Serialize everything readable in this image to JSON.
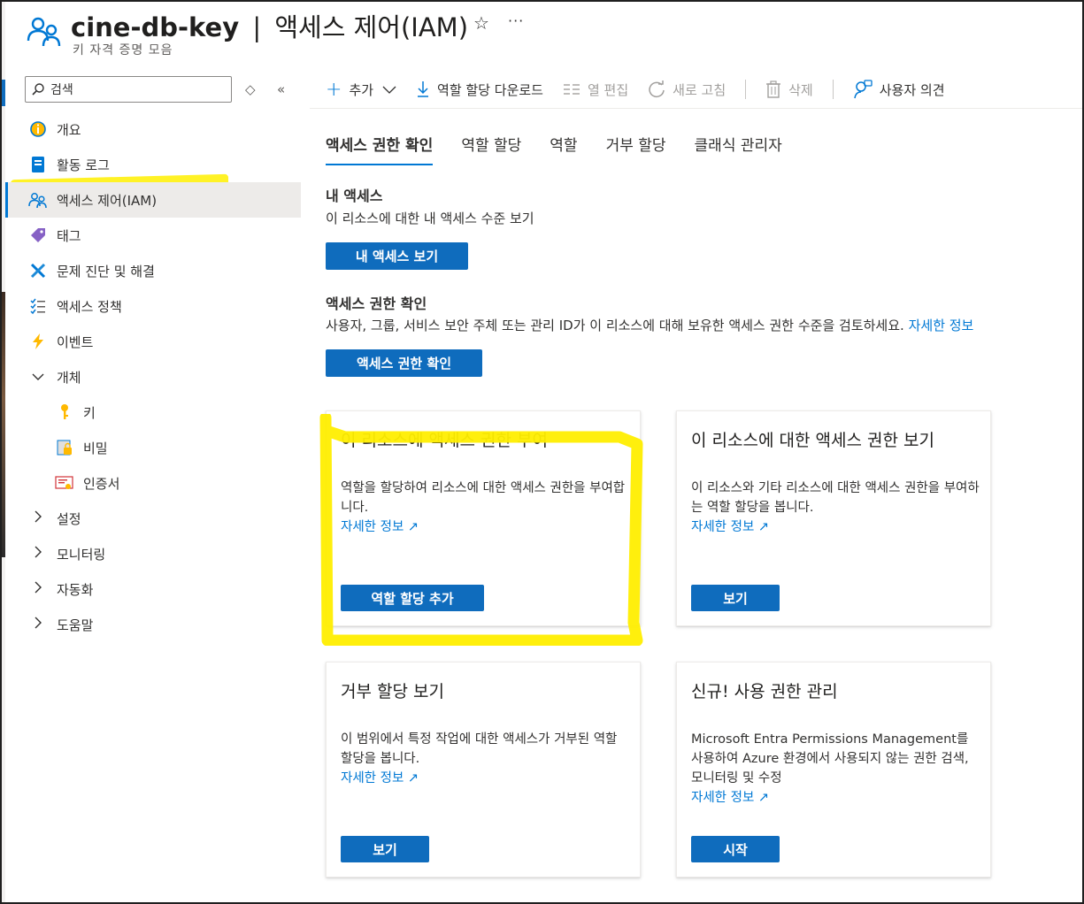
{
  "header": {
    "resource": "cine-db-key",
    "separator": "|",
    "page": "액세스 제어(IAM)",
    "subtitle": "키 자격 증명 모음",
    "star_icon": "star-icon",
    "more": "···"
  },
  "sidebar": {
    "search_placeholder": "검색",
    "items": [
      {
        "label": "개요",
        "icon": "overview-icon"
      },
      {
        "label": "활동 로그",
        "icon": "activity-log-icon"
      },
      {
        "label": "액세스 제어(IAM)",
        "icon": "iam-icon"
      },
      {
        "label": "태그",
        "icon": "tag-icon"
      },
      {
        "label": "문제 진단 및 해결",
        "icon": "diagnose-icon"
      },
      {
        "label": "액세스 정책",
        "icon": "access-policy-icon"
      },
      {
        "label": "이벤트",
        "icon": "events-icon"
      },
      {
        "label": "개체",
        "icon": "chevron-down-icon"
      },
      {
        "label": "키",
        "icon": "key-icon"
      },
      {
        "label": "비밀",
        "icon": "secret-icon"
      },
      {
        "label": "인증서",
        "icon": "certificate-icon"
      },
      {
        "label": "설정",
        "icon": "chevron-right-icon"
      },
      {
        "label": "모니터링",
        "icon": "chevron-right-icon"
      },
      {
        "label": "자동화",
        "icon": "chevron-right-icon"
      },
      {
        "label": "도움말",
        "icon": "chevron-right-icon"
      }
    ]
  },
  "toolbar": {
    "add": "추가",
    "download": "역할 할당 다운로드",
    "edit_columns": "열 편집",
    "refresh": "새로 고침",
    "delete": "삭제",
    "feedback": "사용자 의견"
  },
  "tabs": [
    "액세스 권한 확인",
    "역할 할당",
    "역할",
    "거부 할당",
    "클래식 관리자"
  ],
  "my_access": {
    "heading": "내 액세스",
    "text": "이 리소스에 대한 내 액세스 수준 보기",
    "button": "내 액세스 보기"
  },
  "check_access": {
    "heading": "액세스 권한 확인",
    "text": "사용자, 그룹, 서비스 보안 주체 또는 관리 ID가 이 리소스에 대해 보유한 액세스 권한 수준을 검토하세요.",
    "link": "자세한 정보",
    "button": "액세스 권한 확인"
  },
  "cards": [
    {
      "title": "이 리소스에 액세스 권한 부여",
      "desc": "역할을 할당하여 리소스에 대한 액세스 권한을 부여합니다.",
      "link": "자세한 정보",
      "button": "역할 할당 추가"
    },
    {
      "title": "이 리소스에 대한 액세스 권한 보기",
      "desc": "이 리소스와 기타 리소스에 대한 액세스 권한을 부여하는 역할 할당을 봅니다.",
      "link": "자세한 정보",
      "button": "보기"
    },
    {
      "title": "거부 할당 보기",
      "desc": "이 범위에서 특정 작업에 대한 액세스가 거부된 역할 할당을 봅니다.",
      "link": "자세한 정보",
      "button": "보기"
    },
    {
      "title": "신규! 사용 권한 관리",
      "desc": "Microsoft Entra Permissions Management를 사용하여 Azure 환경에서 사용되지 않는 권한 검색, 모니터링 및 수정",
      "link": "자세한 정보",
      "button": "시작"
    }
  ],
  "colors": {
    "accent": "#0f6cbd",
    "highlight": "#ffee00",
    "link": "#0078d4"
  }
}
